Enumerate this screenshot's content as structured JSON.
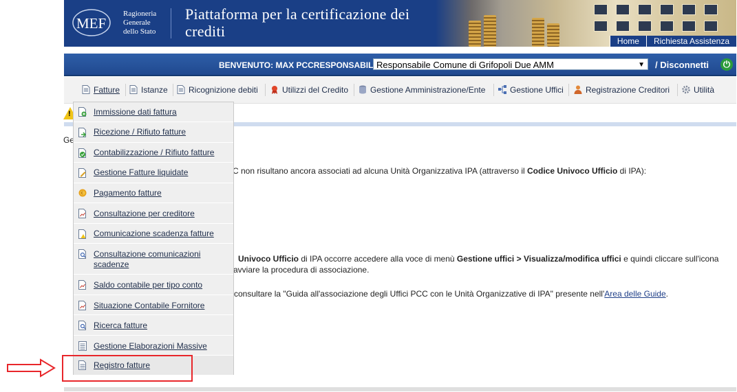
{
  "header": {
    "org": "Ragioneria\nGenerale\ndello Stato",
    "logo_text": "MEF",
    "title": "Piattaforma per la certificazione dei crediti",
    "nav": [
      "Home",
      "Richiesta Assistenza"
    ]
  },
  "welcome": {
    "label": "BENVENUTO: MAX PCCRESPONSABILE",
    "role": "Responsabile Comune di Grifopoli Due AMM",
    "logout": "/ Disconnetti"
  },
  "menu": [
    {
      "label": "Fatture",
      "icon": "document-icon"
    },
    {
      "label": "Istanze",
      "icon": "document-icon"
    },
    {
      "label": "Ricognizione debiti",
      "icon": "document-icon"
    },
    {
      "label": "Utilizzi del Credito",
      "icon": "ribbon-icon"
    },
    {
      "label": "Gestione Amministrazione/Ente",
      "icon": "database-icon"
    },
    {
      "label": "Gestione Uffici",
      "icon": "network-icon"
    },
    {
      "label": "Registrazione Creditori",
      "icon": "user-icon"
    },
    {
      "label": "Utilità",
      "icon": "gear-icon"
    }
  ],
  "dropdown": [
    {
      "label": "Immissione dati fattura",
      "icon": "add-document-icon"
    },
    {
      "label": "Ricezione / Rifiuto fatture",
      "icon": "receive-document-icon"
    },
    {
      "label": "Contabilizzazione / Rifiuto fatture",
      "icon": "check-document-icon"
    },
    {
      "label": "Gestione Fatture liquidate",
      "icon": "edit-document-icon"
    },
    {
      "label": "Pagamento fatture",
      "icon": "coin-icon"
    },
    {
      "label": "Consultazione per creditore",
      "icon": "chart-document-icon"
    },
    {
      "label": "Comunicazione scadenza fatture",
      "icon": "alert-document-icon"
    },
    {
      "label": "Consultazione comunicazioni scadenze",
      "icon": "search-document-icon"
    },
    {
      "label": "Saldo contabile per tipo conto",
      "icon": "chart-document-icon"
    },
    {
      "label": "Situazione Contabile Fornitore",
      "icon": "chart-document-icon"
    },
    {
      "label": "Ricerca fatture",
      "icon": "search-document-icon"
    },
    {
      "label": "Gestione Elaborazioni Massive",
      "icon": "list-document-icon"
    },
    {
      "label": "Registro fatture",
      "icon": "document-icon"
    }
  ],
  "content": {
    "gen_fragment": "Ger",
    "line1_pre": "C non risultano ancora associati ad alcuna Unità Organizzativa IPA (attraverso il ",
    "line1_bold": "Codice Univoco Ufficio",
    "line1_post": " di IPA):",
    "line2_bold1": "Univoco Ufficio",
    "line2_mid1": " di IPA occorre accedere alla voce di menù ",
    "line2_bold2": "Gestione uffici > Visualizza/modifica uffici",
    "line2_post": " e quindi cliccare sull'icona",
    "line3": "avviare la procedura di associazione.",
    "line4_pre": "consultare la \"Guida all'associazione degli Uffici PCC con le Unità Organizzative di IPA\" presente nell'",
    "line4_link": "Area delle Guide",
    "line4_post": "."
  },
  "colors": {
    "brand_blue": "#1a3f86",
    "highlight_red": "#e8262a",
    "warning_yellow": "#f0c417"
  }
}
